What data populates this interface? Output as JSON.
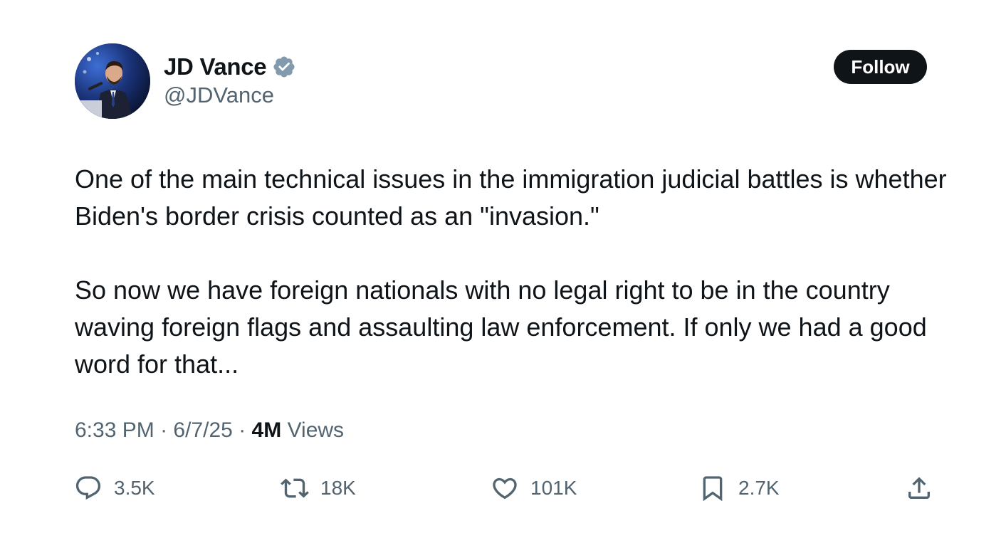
{
  "author": {
    "display_name": "JD Vance",
    "handle": "@JDVance",
    "verified": true,
    "avatar_icon": "profile-photo"
  },
  "follow_button": {
    "label": "Follow"
  },
  "tweet": {
    "paragraphs": [
      "One of the main technical issues in the immigration judicial battles is whether Biden's border crisis counted as an \"invasion.\"",
      "So now we have foreign nationals with no legal right to be in the country waving foreign flags and assaulting law enforcement. If only we had a good word for that..."
    ]
  },
  "meta": {
    "time": "6:33 PM",
    "separator": "·",
    "date": "6/7/25",
    "views_count": "4M",
    "views_label": "Views"
  },
  "actions": {
    "reply": {
      "icon": "reply-icon",
      "count": "3.5K"
    },
    "repost": {
      "icon": "repost-icon",
      "count": "18K"
    },
    "like": {
      "icon": "heart-icon",
      "count": "101K"
    },
    "bookmark": {
      "icon": "bookmark-icon",
      "count": "2.7K"
    },
    "share": {
      "icon": "share-icon"
    }
  },
  "colors": {
    "text_primary": "#0f1419",
    "text_secondary": "#536471",
    "verified_badge": "#829aab",
    "follow_bg": "#0f1419",
    "follow_text": "#ffffff"
  }
}
